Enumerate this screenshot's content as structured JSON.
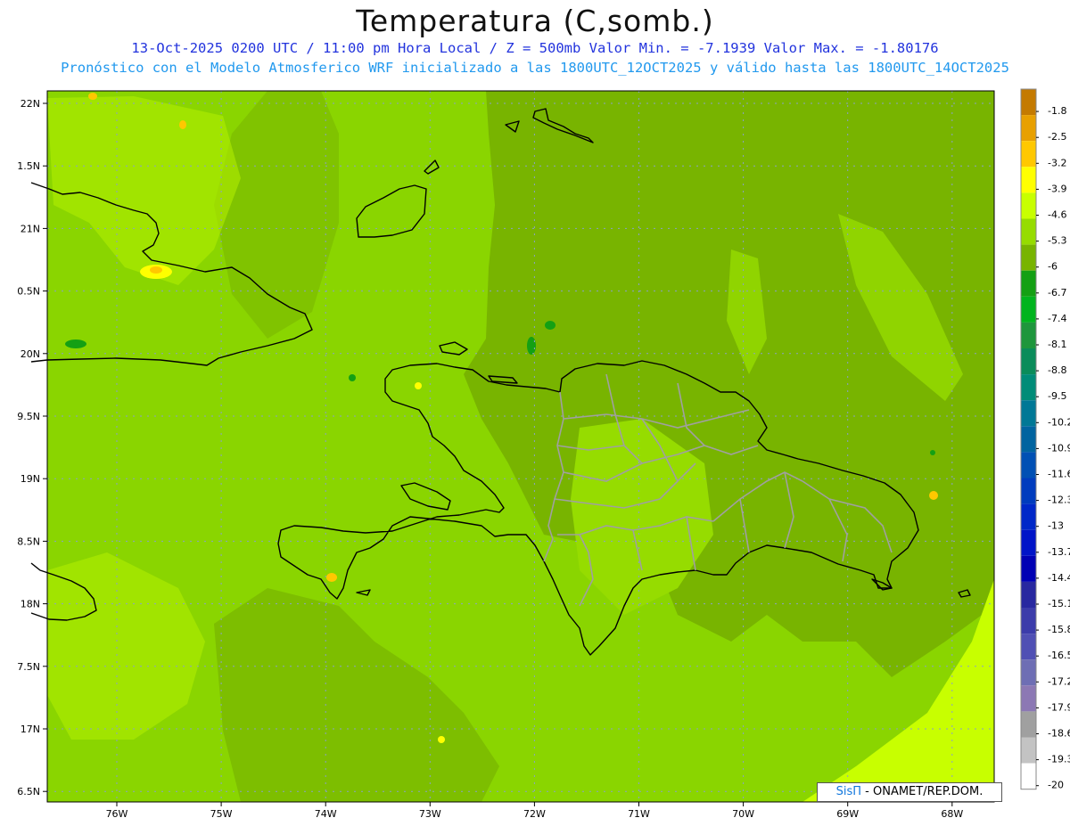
{
  "title": "Temperatura (C,somb.)",
  "subtitle1": "13-Oct-2025  0200 UTC / 11:00 pm Hora Local / Z = 500mb  Valor Min. = -7.1939  Valor Max. = -1.80176",
  "subtitle2": "Pronóstico con el Modelo Atmosferico WRF inicializado a las 1800UTC_12OCT2025 y válido hasta las  1800UTC_14OCT2025",
  "lat_labels": [
    "22N",
    "1.5N",
    "21N",
    "0.5N",
    "20N",
    "9.5N",
    "19N",
    "8.5N",
    "18N",
    "7.5N",
    "17N",
    "6.5N"
  ],
  "lon_labels": [
    "76W",
    "75W",
    "74W",
    "73W",
    "72W",
    "71W",
    "70W",
    "69W",
    "68W"
  ],
  "legend": {
    "labels": [
      "-1.8",
      "-2.5",
      "-3.2",
      "-3.9",
      "-4.6",
      "-5.3",
      "-6",
      "-6.7",
      "-7.4",
      "-8.1",
      "-8.8",
      "-9.5",
      "-10.2",
      "-10.9",
      "-11.6",
      "-12.3",
      "-13",
      "-13.7",
      "-14.4",
      "-15.1",
      "-15.8",
      "-16.5",
      "-17.2",
      "-17.9",
      "-18.6",
      "-19.3",
      "-20"
    ],
    "colors": [
      "#c47a00",
      "#e8a000",
      "#ffc800",
      "#ffff00",
      "#c8ff00",
      "#96dc00",
      "#78b400",
      "#14a014",
      "#00b41e",
      "#1e963c",
      "#0a8c5a",
      "#008c78",
      "#007896",
      "#0064a0",
      "#0050b4",
      "#003cbe",
      "#0028c8",
      "#0014c8",
      "#0000b4",
      "#2828a0",
      "#3c3caa",
      "#5050b4",
      "#6e6eb4",
      "#8c78b4",
      "#a0a0a0",
      "#c3c3c3",
      "#ffffff"
    ]
  },
  "colors": {
    "sea_base": "#8ad500",
    "warm_patch": "#b4f000",
    "cool_patch": "#78b400",
    "hot_spot": "#ffc800",
    "cold_spot": "#14a014",
    "coast": "#000000",
    "border": "#a0a0a0"
  },
  "credit": {
    "brand": "SisΠ",
    "text": "- ONAMET/REP.DOM."
  }
}
